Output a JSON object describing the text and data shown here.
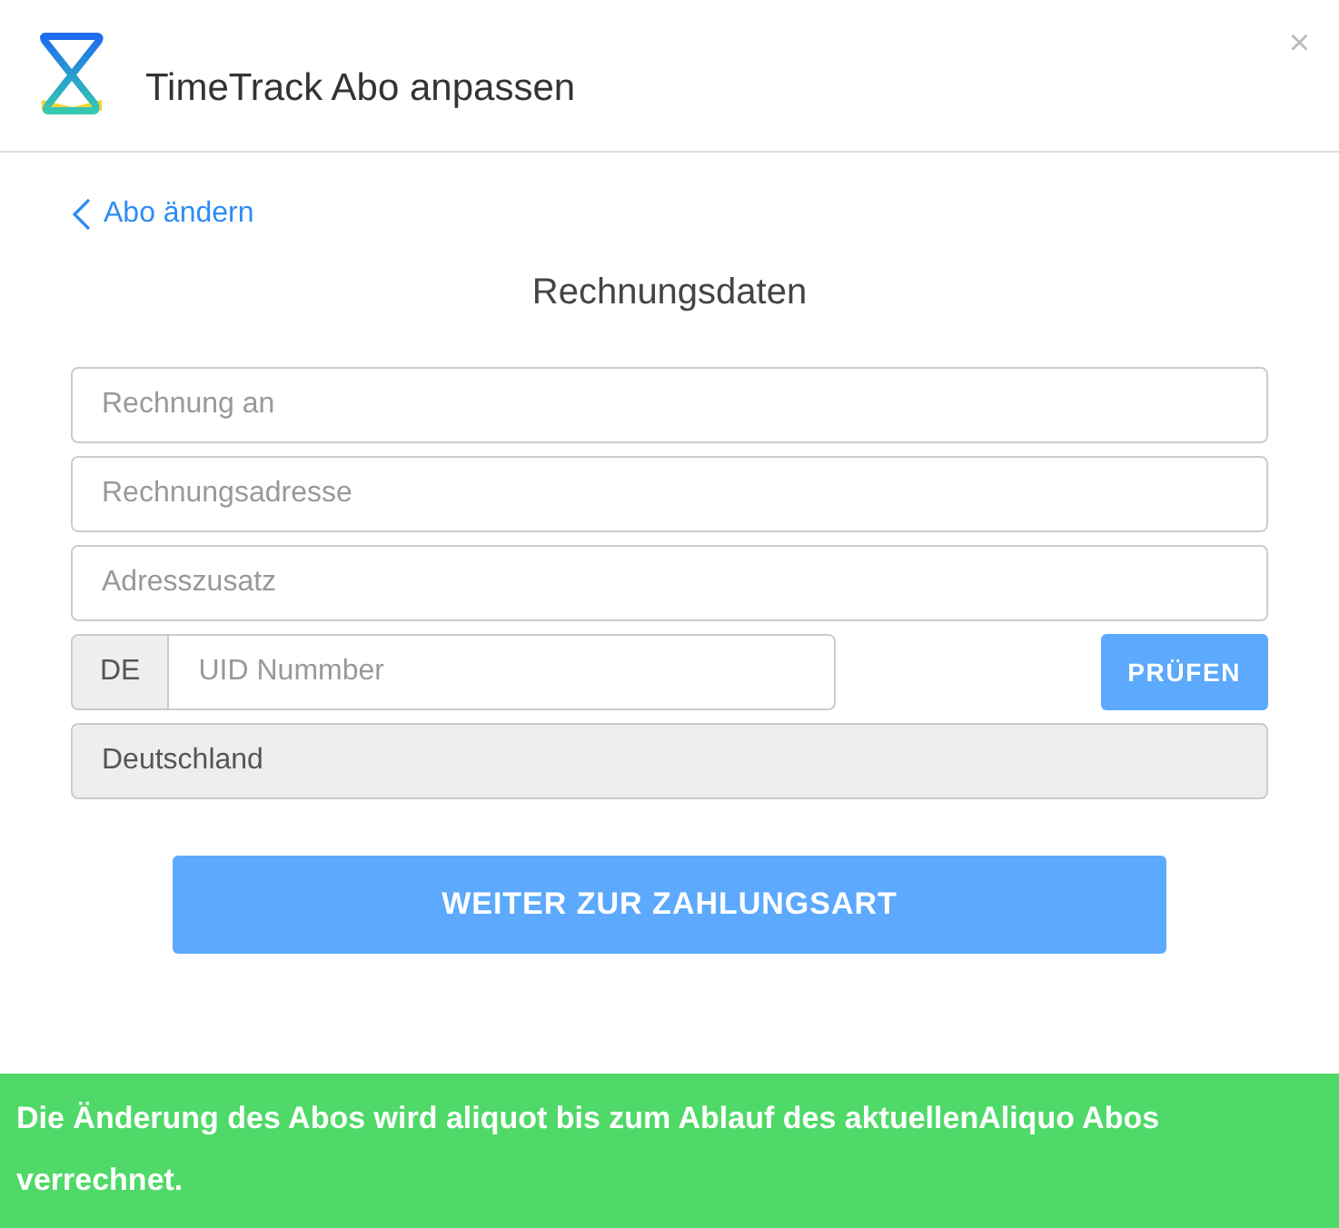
{
  "window": {
    "title": "TimeTrack Abo anpassen",
    "close": "×"
  },
  "back_link": {
    "label": "Abo ändern"
  },
  "section_title": "Rechnungsdaten",
  "fields": [
    {
      "kind": "text",
      "placeholder": "Rechnung an",
      "disabled": false
    },
    {
      "kind": "text",
      "placeholder": "Rechnungsadresse",
      "disabled": false
    },
    {
      "kind": "text",
      "placeholder": "Adresszusatz",
      "disabled": false
    },
    {
      "kind": "uid",
      "prefix": "DE",
      "placeholder": "UID Nummber",
      "button": "PRÜFEN",
      "disabled": false
    },
    {
      "kind": "text",
      "value": "Deutschland",
      "disabled": true
    }
  ],
  "submit_button": "WEITER ZUR ZAHLUNGSART",
  "notice": "Die Änderung des Abos wird aliquot bis zum Ablauf des aktuellenAliquo Abos verrechnet."
}
